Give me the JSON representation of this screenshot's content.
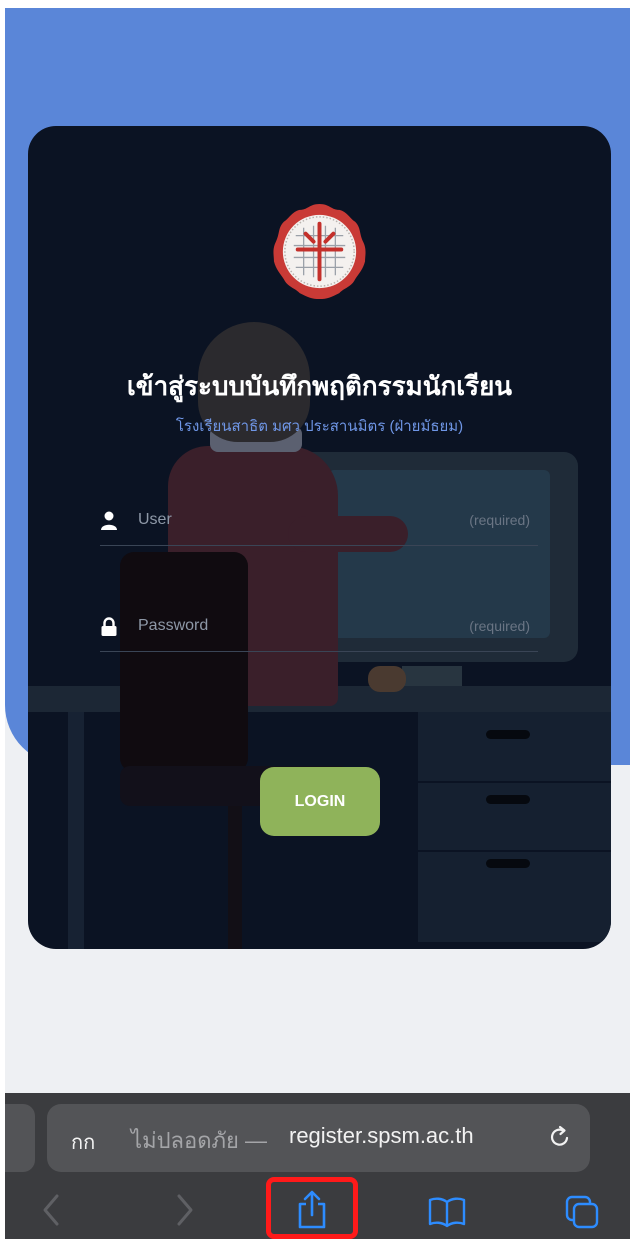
{
  "app": {
    "title": "เข้าสู่ระบบบันทึกพฤติกรรมนักเรียน",
    "subtitle": "โรงเรียนสาธิต มศว ประสานมิตร (ฝ่ายมัธยม)"
  },
  "form": {
    "user": {
      "placeholder": "User",
      "hint": "(required)",
      "icon": "user-icon"
    },
    "password": {
      "placeholder": "Password",
      "hint": "(required)",
      "icon": "lock-icon"
    },
    "login_label": "LOGIN"
  },
  "browser": {
    "text_size_label": "กก",
    "security_label": "ไม่ปลอดภัย —",
    "domain": "register.spsm.ac.th",
    "reload_icon": "reload-icon",
    "nav_icons": [
      "back-icon",
      "forward-icon",
      "share-icon",
      "bookmarks-icon",
      "tabs-icon"
    ]
  },
  "colors": {
    "accent_blue": "#5a86d8",
    "card_bg": "#0b1323",
    "login_button": "#8fb35a",
    "subtitle": "#6f96e6",
    "highlight": "#ff1a1a"
  }
}
